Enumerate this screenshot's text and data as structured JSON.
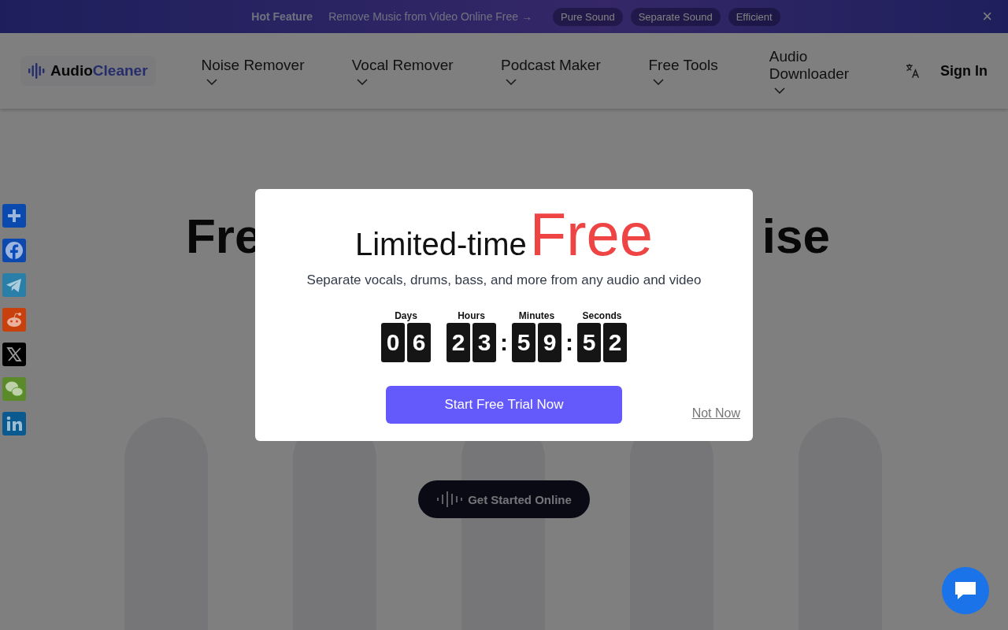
{
  "promo_bar": {
    "label": "Hot Feature",
    "link": "Remove Music from Video Online Free",
    "arrow": "→",
    "tags": [
      "Pure Sound",
      "Separate Sound",
      "Efficient"
    ],
    "close": "×"
  },
  "header": {
    "logo": {
      "first": "Audio",
      "second": "Cleaner"
    },
    "nav": [
      {
        "label": "Noise Remover",
        "dropdown": true
      },
      {
        "label": "Vocal Remover",
        "dropdown": true
      },
      {
        "label": "Podcast Maker",
        "dropdown": true
      },
      {
        "label": "Free Tools",
        "dropdown": true
      },
      {
        "label": "Audio Downloader",
        "dropdown": true
      }
    ],
    "sign_in": "Sign In"
  },
  "share_buttons": [
    {
      "kind": "share",
      "color": "#0a4aae"
    },
    {
      "kind": "facebook",
      "color": "#0c48ad"
    },
    {
      "kind": "telegram",
      "color": "#2a7fa8"
    },
    {
      "kind": "reddit",
      "color": "#c8400c"
    },
    {
      "kind": "x",
      "color": "#000000"
    },
    {
      "kind": "wechat",
      "color": "#5a8a2a"
    },
    {
      "kind": "linkedin",
      "color": "#0a5a90"
    }
  ],
  "hero": {
    "title_left": "Fre",
    "title_right": "ise",
    "cta": "Get Started Online"
  },
  "modal": {
    "title": "Limited-time",
    "title_highlight": "Free",
    "subtitle": "Separate vocals, drums, bass, and more from any audio and video",
    "countdown": [
      {
        "label": "Days",
        "digits": [
          "0",
          "6"
        ]
      },
      {
        "label": "Hours",
        "digits": [
          "2",
          "3"
        ]
      },
      {
        "label": "Minutes",
        "separator": ":",
        "digits": [
          "5",
          "9"
        ]
      },
      {
        "label": "Seconds",
        "separator": ":",
        "digits": [
          "5",
          "2"
        ]
      }
    ],
    "primary_button": "Start Free Trial Now",
    "dismiss": "Not Now"
  }
}
